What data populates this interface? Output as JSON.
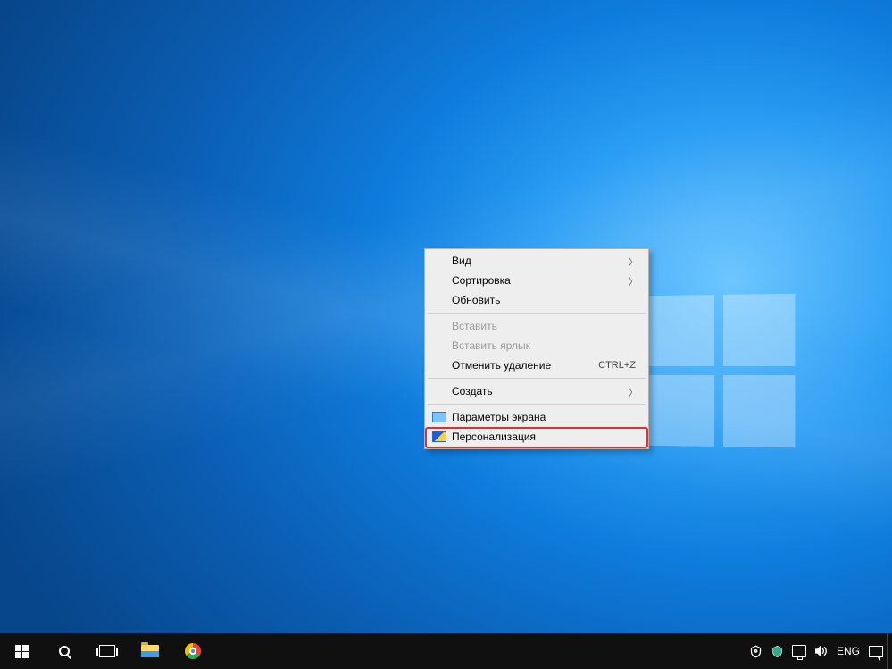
{
  "context_menu": {
    "items": [
      {
        "label": "Вид",
        "has_submenu": true
      },
      {
        "label": "Сортировка",
        "has_submenu": true
      },
      {
        "label": "Обновить"
      }
    ],
    "group2": [
      {
        "label": "Вставить",
        "disabled": true
      },
      {
        "label": "Вставить ярлык",
        "disabled": true
      },
      {
        "label": "Отменить удаление",
        "shortcut": "CTRL+Z"
      }
    ],
    "group3": [
      {
        "label": "Создать",
        "has_submenu": true
      }
    ],
    "group4": [
      {
        "label": "Параметры экрана",
        "icon": "display"
      },
      {
        "label": "Персонализация",
        "icon": "personalize",
        "highlighted": true
      }
    ]
  },
  "taskbar": {
    "tray": {
      "language": "ENG"
    }
  }
}
